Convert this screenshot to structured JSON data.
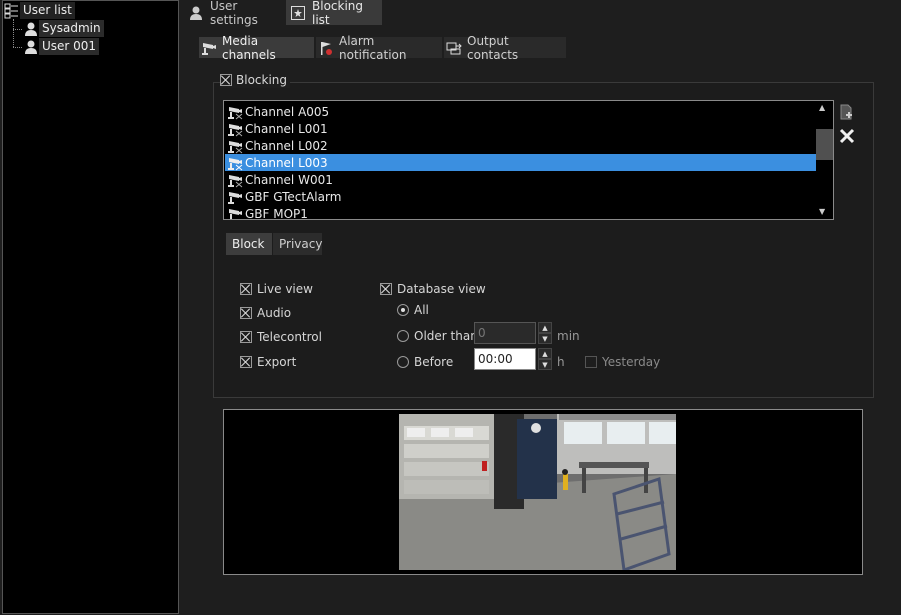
{
  "tree": {
    "root_label": "User list",
    "children": [
      {
        "label": "Sysadmin"
      },
      {
        "label": "User 001"
      }
    ]
  },
  "top_tabs": [
    {
      "label": "User settings",
      "icon": "user-icon"
    },
    {
      "label": "Blocking list",
      "icon": "star-box-icon",
      "active": true
    }
  ],
  "sub_tabs": [
    {
      "label": "Media channels",
      "icon": "camera-icon",
      "active": true
    },
    {
      "label": "Alarm notification",
      "icon": "alarm-flag-icon"
    },
    {
      "label": "Output contacts",
      "icon": "output-contacts-icon"
    }
  ],
  "blocking": {
    "label": "Blocking",
    "checked": true,
    "channels": [
      {
        "label": "Channel A005"
      },
      {
        "label": "Channel L001"
      },
      {
        "label": "Channel L002"
      },
      {
        "label": "Channel L003",
        "selected": true
      },
      {
        "label": "Channel W001"
      },
      {
        "label": "GBF GTectAlarm"
      },
      {
        "label": "GBF MOP1"
      }
    ],
    "add_button_icon": "add-item-icon",
    "remove_button_icon": "close-icon"
  },
  "detail_tabs": [
    {
      "label": "Block",
      "active": true
    },
    {
      "label": "Privacy"
    }
  ],
  "block_options": {
    "live_view": "Live view",
    "audio": "Audio",
    "telecontrol": "Telecontrol",
    "export": "Export",
    "database_view": "Database view",
    "all": "All",
    "older_than": "Older than",
    "older_than_value": "0",
    "older_than_unit": "min",
    "before": "Before",
    "before_value": "00:00",
    "before_unit": "h",
    "yesterday": "Yesterday"
  },
  "colors": {
    "selection": "#3b8fe0",
    "background": "#1e1e1e"
  }
}
